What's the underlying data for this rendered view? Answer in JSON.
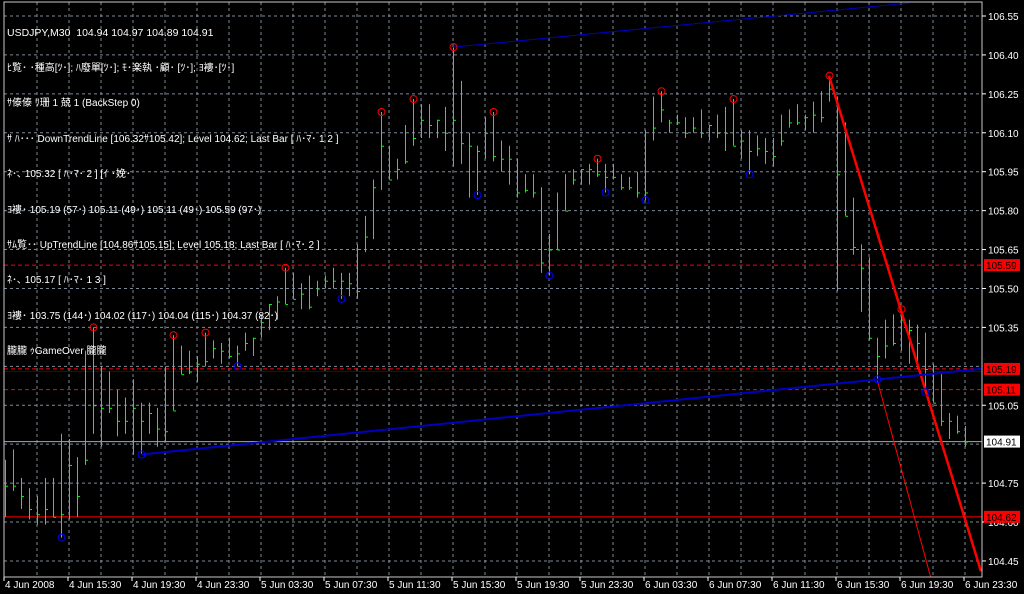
{
  "info_lines": [
    "USDJPY,M30  104.94 104.97 104.89 104.91",
    "ﾋ覧･ ･種高[ﾂ･]; ﾊ廢單[ﾂ･]; ﾓ･楽執 ･顧･ [ﾂ･]; ﾖ褸･[ﾂ･]",
    "ｻ傣傣 ﾘ珊 1 兢 1 (BackStep 0)",
    "ｻ ﾊ･･･ DownTrendLine [106.32ｻ105.42]; Level 104.62; Last Bar [ ﾊ･ﾏ･ 1 2 ]",
    "ﾈ･､ 105.32 [ ﾊ･ﾏ･ 2 ] [ｲ ･娩･",
    "ﾖ褸･ 105.19 (57･) 105.11 (49･) 105.11 (49･) 105.59 (97･)",
    "ｻﾑ覧･･ UpTrendLine [104.86ｻ105.15]; Level 105.18; Last Bar [ ﾊ･ﾏ･ 2 ]",
    "ﾈ･､ 105.17 [ ﾊ･ﾏ･ 1 3 ]",
    "ﾖ褸･ 103.75 (144･) 104.02 (117･) 104.04 (115･) 104.37 (82･)",
    "朧朧 ｩGameOver 朧朧"
  ],
  "chart_data": {
    "type": "ohlc-bar",
    "symbol": "USDJPY,M30",
    "ylim": [
      104.4,
      106.6
    ],
    "y_ticks": [
      "106.55",
      "106.40",
      "106.25",
      "106.10",
      "105.95",
      "105.80",
      "105.65",
      "105.50",
      "105.35",
      "105.05",
      "104.75",
      "104.60",
      "104.45"
    ],
    "x_ticks": [
      "4 Jun 2008",
      "4 Jun 15:30",
      "4 Jun 19:30",
      "4 Jun 23:30",
      "5 Jun 03:30",
      "5 Jun 07:30",
      "5 Jun 11:30",
      "5 Jun 15:30",
      "5 Jun 19:30",
      "5 Jun 23:30",
      "6 Jun 03:30",
      "6 Jun 07:30",
      "6 Jun 11:30",
      "6 Jun 15:30",
      "6 Jun 19:30",
      "6 Jun 23:30"
    ],
    "bars_hlc": [
      [
        104.84,
        104.62,
        104.74
      ],
      [
        104.88,
        104.72,
        104.74
      ],
      [
        104.77,
        104.65,
        104.7
      ],
      [
        104.73,
        104.61,
        104.65
      ],
      [
        104.7,
        104.59,
        104.63
      ],
      [
        104.77,
        104.59,
        104.65
      ],
      [
        104.77,
        104.62,
        104.62
      ],
      [
        104.94,
        104.54,
        104.63
      ],
      [
        104.92,
        104.61,
        104.82
      ],
      [
        104.85,
        104.62,
        104.7
      ],
      [
        105.26,
        104.82,
        104.84
      ],
      [
        105.35,
        104.94,
        105.05
      ],
      [
        105.2,
        104.89,
        105.04
      ],
      [
        105.18,
        105.02,
        105.04
      ],
      [
        105.11,
        104.93,
        104.99
      ],
      [
        105.08,
        104.94,
        104.99
      ],
      [
        105.15,
        104.86,
        105.04
      ],
      [
        105.06,
        104.86,
        104.99
      ],
      [
        105.06,
        104.94,
        105.02
      ],
      [
        105.04,
        104.89,
        104.96
      ],
      [
        105.2,
        104.91,
        104.95
      ],
      [
        105.32,
        105.03,
        105.03
      ],
      [
        105.28,
        105.17,
        105.17
      ],
      [
        105.26,
        105.17,
        105.18
      ],
      [
        105.24,
        105.14,
        105.21
      ],
      [
        105.33,
        105.2,
        105.22
      ],
      [
        105.3,
        105.23,
        105.27
      ],
      [
        105.29,
        105.21,
        105.26
      ],
      [
        105.31,
        105.23,
        105.24
      ],
      [
        105.28,
        105.2,
        105.25
      ],
      [
        105.33,
        105.26,
        105.29
      ],
      [
        105.31,
        105.24,
        105.31
      ],
      [
        105.4,
        105.31,
        105.37
      ],
      [
        105.44,
        105.34,
        105.44
      ],
      [
        105.47,
        105.38,
        105.45
      ],
      [
        105.58,
        105.44,
        105.44
      ],
      [
        105.56,
        105.46,
        105.46
      ],
      [
        105.52,
        105.42,
        105.48
      ],
      [
        105.55,
        105.42,
        105.43
      ],
      [
        105.53,
        105.47,
        105.5
      ],
      [
        105.55,
        105.5,
        105.53
      ],
      [
        105.58,
        105.5,
        105.53
      ],
      [
        105.56,
        105.46,
        105.53
      ],
      [
        105.56,
        105.47,
        105.52
      ],
      [
        105.67,
        105.46,
        105.49
      ],
      [
        105.78,
        105.64,
        105.7
      ],
      [
        105.92,
        105.69,
        105.89
      ],
      [
        106.18,
        105.88,
        106.05
      ],
      [
        106.05,
        105.92,
        105.92
      ],
      [
        106.0,
        105.92,
        105.96
      ],
      [
        106.13,
        105.98,
        105.99
      ],
      [
        106.23,
        106.05,
        106.08
      ],
      [
        106.21,
        106.08,
        106.15
      ],
      [
        106.21,
        106.08,
        106.13
      ],
      [
        106.15,
        106.08,
        106.15
      ],
      [
        106.2,
        106.03,
        106.1
      ],
      [
        106.43,
        105.97,
        106.15
      ],
      [
        106.3,
        105.98,
        106.06
      ],
      [
        106.1,
        105.85,
        106.05
      ],
      [
        106.05,
        105.86,
        106.03
      ],
      [
        106.16,
        106.0,
        106.1
      ],
      [
        106.18,
        105.99,
        106.01
      ],
      [
        106.07,
        105.95,
        106.0
      ],
      [
        106.05,
        105.9,
        106.0
      ],
      [
        106.0,
        105.85,
        105.87
      ],
      [
        105.94,
        105.87,
        105.88
      ],
      [
        105.94,
        105.85,
        105.87
      ],
      [
        105.89,
        105.56,
        105.6
      ],
      [
        105.71,
        105.55,
        105.65
      ],
      [
        105.87,
        105.65,
        105.65
      ],
      [
        105.94,
        105.8,
        105.8
      ],
      [
        105.96,
        105.9,
        105.92
      ],
      [
        105.96,
        105.9,
        105.96
      ],
      [
        105.98,
        105.9,
        105.96
      ],
      [
        106.0,
        105.93,
        105.94
      ],
      [
        105.98,
        105.87,
        105.93
      ],
      [
        105.98,
        105.92,
        105.93
      ],
      [
        105.94,
        105.88,
        105.89
      ],
      [
        105.93,
        105.88,
        105.89
      ],
      [
        105.95,
        105.85,
        105.87
      ],
      [
        106.11,
        105.84,
        105.87
      ],
      [
        106.24,
        106.07,
        106.12
      ],
      [
        106.26,
        106.14,
        106.19
      ],
      [
        106.15,
        106.1,
        106.14
      ],
      [
        106.17,
        106.13,
        106.14
      ],
      [
        106.16,
        106.08,
        106.1
      ],
      [
        106.16,
        106.1,
        106.12
      ],
      [
        106.19,
        106.08,
        106.1
      ],
      [
        106.13,
        106.07,
        106.13
      ],
      [
        106.17,
        106.08,
        106.1
      ],
      [
        106.2,
        106.03,
        106.1
      ],
      [
        106.23,
        106.05,
        106.05
      ],
      [
        106.11,
        106.0,
        106.07
      ],
      [
        106.11,
        105.94,
        106.03
      ],
      [
        106.09,
        106.01,
        106.04
      ],
      [
        106.08,
        105.98,
        106.03
      ],
      [
        106.08,
        105.97,
        106.01
      ],
      [
        106.17,
        106.05,
        106.07
      ],
      [
        106.19,
        106.12,
        106.14
      ],
      [
        106.21,
        106.13,
        106.14
      ],
      [
        106.17,
        106.11,
        106.16
      ],
      [
        106.22,
        106.1,
        106.17
      ],
      [
        106.26,
        106.14,
        106.16
      ],
      [
        106.32,
        106.22,
        106.27
      ],
      [
        106.24,
        105.49,
        105.94
      ],
      [
        106.14,
        105.78,
        105.78
      ],
      [
        105.85,
        105.63,
        105.66
      ],
      [
        105.67,
        105.41,
        105.58
      ],
      [
        105.62,
        105.3,
        105.31
      ],
      [
        105.31,
        105.15,
        105.24
      ],
      [
        105.38,
        105.23,
        105.28
      ],
      [
        105.4,
        105.28,
        105.29
      ],
      [
        105.42,
        105.26,
        105.38
      ],
      [
        105.38,
        105.21,
        105.34
      ],
      [
        105.36,
        105.19,
        105.29
      ],
      [
        105.33,
        105.1,
        105.19
      ],
      [
        105.21,
        105.06,
        105.06
      ],
      [
        105.17,
        104.97,
        104.99
      ],
      [
        105.02,
        104.92,
        104.99
      ],
      [
        105.01,
        104.94,
        104.95
      ],
      [
        104.97,
        104.89,
        104.91
      ]
    ],
    "swing_highs": [
      11,
      21,
      25,
      35,
      47,
      51,
      56,
      61,
      74,
      82,
      91,
      103,
      112
    ],
    "swing_lows": [
      7,
      17,
      29,
      42,
      59,
      68,
      75,
      80,
      93,
      109,
      115
    ],
    "trend_lines": [
      {
        "name": "down-trend-line",
        "color": "#ff0000",
        "from": [
          103,
          106.32
        ],
        "to": [
          122,
          104.41
        ],
        "width": 2.5
      },
      {
        "name": "down-trend-projection",
        "color": "#ff0000",
        "from": [
          109,
          105.15
        ],
        "to": [
          116.3,
          104.32
        ],
        "width": 1
      },
      {
        "name": "up-trend-line",
        "color": "#0000c0",
        "from": [
          17,
          104.86
        ],
        "to": [
          122,
          105.19
        ],
        "width": 2
      },
      {
        "name": "upper-channel-line",
        "color": "#0000c0",
        "from": [
          56,
          106.43
        ],
        "to": [
          113,
          106.6
        ],
        "width": 1
      }
    ],
    "levels": [
      {
        "name": "level-105-59",
        "price": 105.59,
        "label": "105.59",
        "color": "#ff0000",
        "style": "dashed",
        "tag": true
      },
      {
        "name": "level-105-19",
        "price": 105.19,
        "label": "105.19",
        "color": "#ff0000",
        "style": "dashed",
        "tag": true
      },
      {
        "name": "uptrend-level-line",
        "price": 105.18,
        "color": "#0000c0",
        "style": "solid",
        "tag": false
      },
      {
        "name": "level-105-11",
        "price": 105.11,
        "label": "105.11",
        "color": "#ff0000",
        "style": "dashed",
        "tag": true
      },
      {
        "name": "bid-line",
        "price": 104.91,
        "label": "104.91",
        "color": "#a0a8b8",
        "style": "solid",
        "tag": true,
        "tag_bg": "#ffffff",
        "tag_fg": "#000000"
      },
      {
        "name": "level-104-62",
        "price": 104.62,
        "label": "104.62",
        "color": "#ff0000",
        "style": "solid",
        "tag": true
      }
    ],
    "colors": {
      "bars": "#00ff00",
      "grid": "#7f8a99",
      "axis": "#ffffff",
      "swing_high": "#ff0000",
      "swing_low": "#0000ff"
    }
  }
}
